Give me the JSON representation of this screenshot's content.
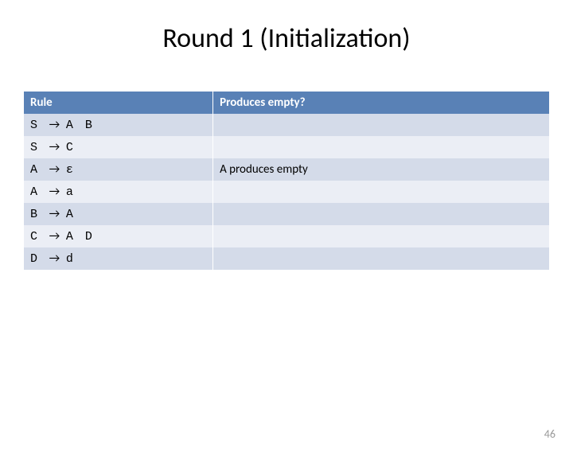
{
  "title": "Round 1 (Initialization)",
  "headers": {
    "rule": "Rule",
    "produces": "Produces empty?"
  },
  "rows": [
    {
      "lhs": "S",
      "arrow": "→",
      "rhs": "A B",
      "produces": ""
    },
    {
      "lhs": "S",
      "arrow": "→",
      "rhs": "C",
      "produces": ""
    },
    {
      "lhs": "A",
      "arrow": "→",
      "rhs": "ε",
      "produces": "A produces empty"
    },
    {
      "lhs": "A",
      "arrow": "→",
      "rhs": "a",
      "produces": ""
    },
    {
      "lhs": "B",
      "arrow": "→",
      "rhs": "A",
      "produces": ""
    },
    {
      "lhs": "C",
      "arrow": "→",
      "rhs": "A D",
      "produces": ""
    },
    {
      "lhs": "D",
      "arrow": "→",
      "rhs": "d",
      "produces": ""
    }
  ],
  "page_number": "46"
}
